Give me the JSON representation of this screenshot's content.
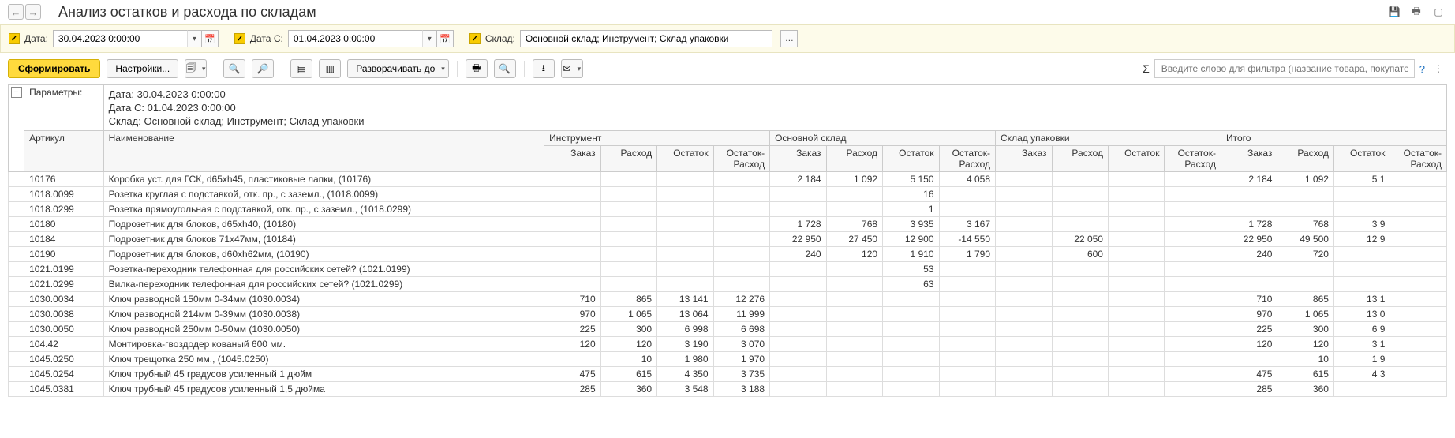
{
  "page": {
    "title": "Анализ остатков и расхода по складам",
    "help": "?"
  },
  "filters": {
    "date": {
      "label": "Дата:",
      "value": "30.04.2023 0:00:00"
    },
    "date_from": {
      "label": "Дата С:",
      "value": "01.04.2023 0:00:00"
    },
    "warehouse": {
      "label": "Склад:",
      "value": "Основной склад; Инструмент; Склад упаковки"
    }
  },
  "toolbar": {
    "run": "Сформировать",
    "settings": "Настройки...",
    "expand_to": "Разворачивать до",
    "filter_placeholder": "Введите слово для фильтра (название товара, покупателя и пр.)",
    "sigma": "Σ"
  },
  "report": {
    "params_label": "Параметры:",
    "params": [
      "Дата: 30.04.2023 0:00:00",
      "Дата С: 01.04.2023 0:00:00",
      "Склад: Основной склад; Инструмент; Склад упаковки"
    ],
    "col_article": "Артикул",
    "col_name": "Наименование",
    "groups": [
      "Инструмент",
      "Основной склад",
      "Склад упаковки",
      "Итого"
    ],
    "subcols": [
      "Заказ",
      "Расход",
      "Остаток",
      "Остаток-Расход"
    ],
    "rows": [
      {
        "art": "10176",
        "name": "Коробка уст. для ГСК, d65xh45, пластиковые лапки, (10176)",
        "g2": [
          "2 184",
          "1 092",
          "5 150",
          "4 058"
        ],
        "g4": [
          "2 184",
          "1 092",
          "5 1"
        ]
      },
      {
        "art": "1018.0099",
        "name": "Розетка круглая с подставкой, отк. пр., с заземл., (1018.0099)",
        "g2": [
          "",
          "",
          "16",
          ""
        ]
      },
      {
        "art": "1018.0299",
        "name": "Розетка прямоугольная с подставкой, отк. пр., с заземл., (1018.0299)",
        "g2": [
          "",
          "",
          "1",
          ""
        ]
      },
      {
        "art": "10180",
        "name": "Подрозетник для блоков, d65xh40, (10180)",
        "g2": [
          "1 728",
          "768",
          "3 935",
          "3 167"
        ],
        "g4": [
          "1 728",
          "768",
          "3 9"
        ]
      },
      {
        "art": "10184",
        "name": "Подрозетник для блоков 71x47мм, (10184)",
        "g2": [
          "22 950",
          "27 450",
          "12 900",
          "-14 550"
        ],
        "g3": [
          "",
          "22 050",
          "",
          ""
        ],
        "g4": [
          "22 950",
          "49 500",
          "12 9"
        ]
      },
      {
        "art": "10190",
        "name": "Подрозетник для блоков, d60xh62мм, (10190)",
        "g2": [
          "240",
          "120",
          "1 910",
          "1 790"
        ],
        "g3": [
          "",
          "600",
          "",
          ""
        ],
        "g4": [
          "240",
          "720",
          ""
        ]
      },
      {
        "art": "1021.0199",
        "name": "Розетка-переходник телефонная для российских сетей? (1021.0199)",
        "g2": [
          "",
          "",
          "53",
          ""
        ]
      },
      {
        "art": "1021.0299",
        "name": "Вилка-переходник телефонная для российских сетей? (1021.0299)",
        "g2": [
          "",
          "",
          "63",
          ""
        ]
      },
      {
        "art": "1030.0034",
        "name": "Ключ разводной 150мм 0-34мм (1030.0034)",
        "g1": [
          "710",
          "865",
          "13 141",
          "12 276"
        ],
        "g4": [
          "710",
          "865",
          "13 1"
        ]
      },
      {
        "art": "1030.0038",
        "name": "Ключ разводной 214мм 0-39мм (1030.0038)",
        "g1": [
          "970",
          "1 065",
          "13 064",
          "11 999"
        ],
        "g4": [
          "970",
          "1 065",
          "13 0"
        ]
      },
      {
        "art": "1030.0050",
        "name": "Ключ разводной 250мм 0-50мм (1030.0050)",
        "g1": [
          "225",
          "300",
          "6 998",
          "6 698"
        ],
        "g4": [
          "225",
          "300",
          "6 9"
        ]
      },
      {
        "art": "104.42",
        "name": "Монтировка-гвоздодер кованый 600 мм.",
        "g1": [
          "120",
          "120",
          "3 190",
          "3 070"
        ],
        "g4": [
          "120",
          "120",
          "3 1"
        ]
      },
      {
        "art": "1045.0250",
        "name": "Ключ трещотка 250 мм., (1045.0250)",
        "g1": [
          "",
          "10",
          "1 980",
          "1 970"
        ],
        "g4": [
          "",
          "10",
          "1 9"
        ]
      },
      {
        "art": "1045.0254",
        "name": "Ключ трубный 45 градусов усиленный 1 дюйм",
        "g1": [
          "475",
          "615",
          "4 350",
          "3 735"
        ],
        "g4": [
          "475",
          "615",
          "4 3"
        ]
      },
      {
        "art": "1045.0381",
        "name": "Ключ трубный 45 градусов усиленный 1,5 дюйма",
        "g1": [
          "285",
          "360",
          "3 548",
          "3 188"
        ],
        "g4": [
          "285",
          "360",
          ""
        ]
      }
    ]
  }
}
